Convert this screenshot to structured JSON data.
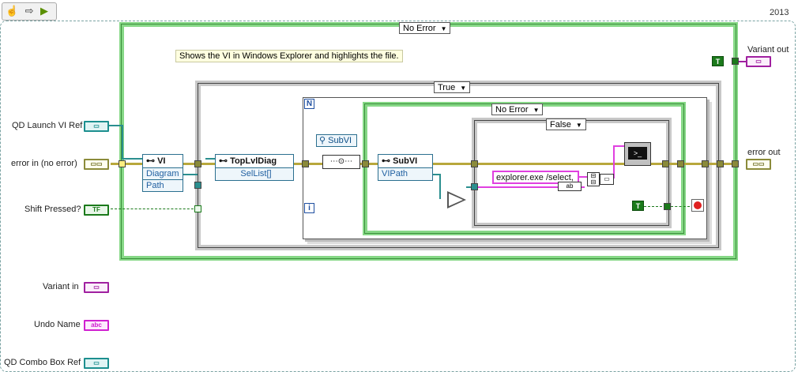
{
  "toolbar": {
    "icons": [
      "hand-icon",
      "arrow-icon",
      "run-icon"
    ]
  },
  "version_label": "2013",
  "comment": "Shows the VI in Windows Explorer and highlights the file.",
  "case_selectors": {
    "outer_error": "No Error",
    "true_case": "True",
    "inner_error": "No Error",
    "false_case": "False"
  },
  "inputs": {
    "qd_launch_vi_ref": "QD Launch VI Ref",
    "error_in": "error in (no error)",
    "shift_pressed": "Shift Pressed?",
    "variant_in": "Variant in",
    "undo_name": "Undo Name",
    "qd_combo_box_ref": "QD Combo Box Ref"
  },
  "outputs": {
    "variant_out": "Variant out",
    "error_out": "error out"
  },
  "nodes": {
    "vi_property": {
      "title": "VI",
      "rows": [
        "Diagram",
        "Path"
      ]
    },
    "toplvldiag_property": {
      "title": "TopLvlDiag",
      "rows": [
        "SelList[]"
      ]
    },
    "subvi_class": "SubVI",
    "subvi_property": {
      "title": "SubVI",
      "rows": [
        "VIPath"
      ]
    }
  },
  "explorer_string": "explorer.exe /select,",
  "terminal_glyphs": {
    "ref": "▭",
    "err": "▭▭",
    "bool": "TF",
    "str": "abc",
    "const_true": "T",
    "index": "i",
    "no_symbol": "N"
  }
}
